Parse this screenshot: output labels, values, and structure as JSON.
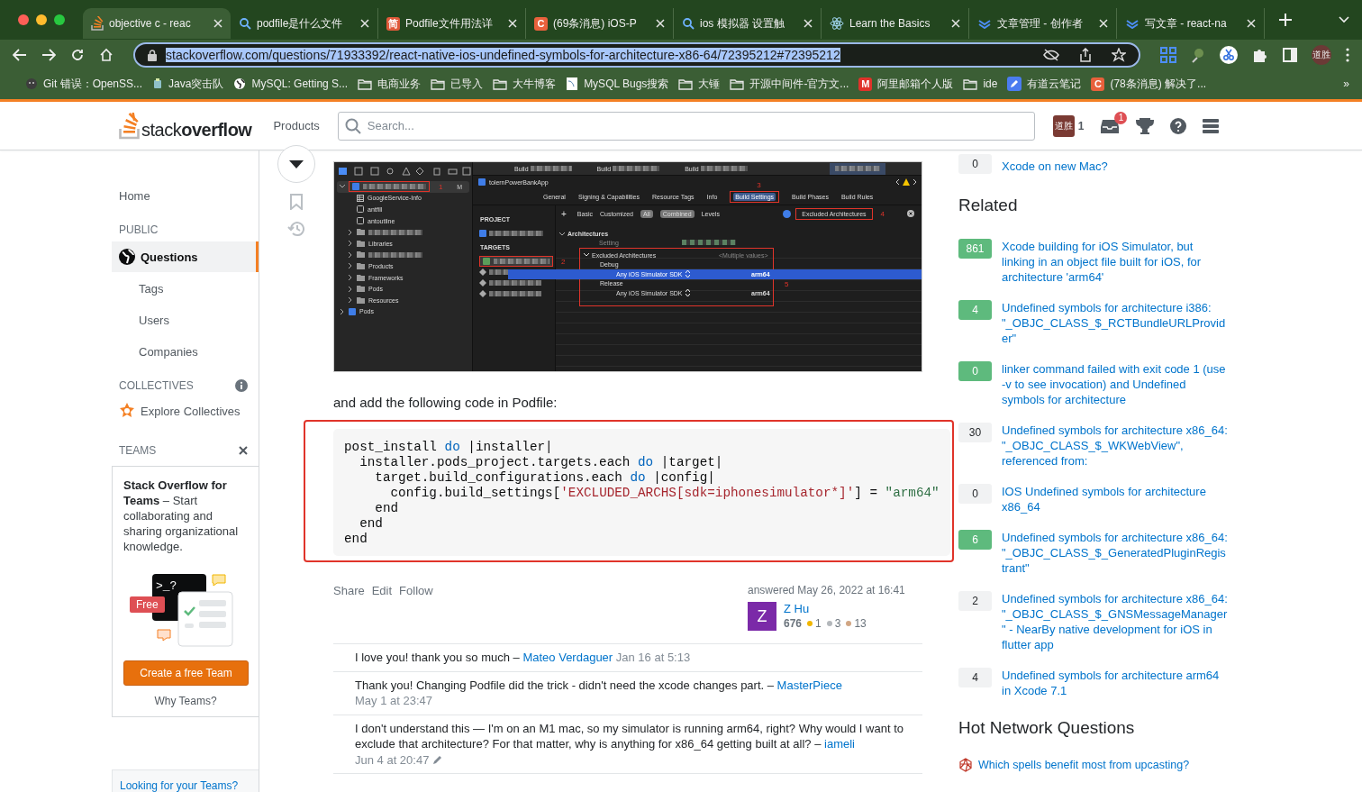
{
  "browser": {
    "tabs": [
      {
        "title": "objective c - reac",
        "kind": "logo",
        "selected": true
      },
      {
        "title": "podfile是什么文件",
        "kind": "search",
        "selected": false
      },
      {
        "title": "Podfile文件用法详",
        "kind": "letter",
        "icon_text": "简",
        "color": "#e05a3a",
        "selected": false
      },
      {
        "title": "(69条消息) iOS-P",
        "kind": "letter",
        "icon_text": "C",
        "color": "#e8613c",
        "selected": false
      },
      {
        "title": "ios 模拟器 设置触",
        "kind": "search",
        "selected": false
      },
      {
        "title": "Learn the Basics",
        "kind": "atom",
        "selected": false
      },
      {
        "title": "文章管理 - 创作者",
        "kind": "chevrons",
        "selected": false
      },
      {
        "title": "写文章 - react-na",
        "kind": "chevrons",
        "selected": false
      }
    ],
    "url": "stackoverflow.com/questions/71933392/react-native-ios-undefined-symbols-for-architecture-x86-64/72395212#72395212",
    "profile": "道胜",
    "bookmarks": [
      {
        "label": "Git 错误：OpenSS...",
        "kind": "octo"
      },
      {
        "label": "Java突击队",
        "kind": "site"
      },
      {
        "label": "MySQL: Getting S...",
        "kind": "globe"
      },
      {
        "label": "电商业务",
        "kind": "folder"
      },
      {
        "label": "已导入",
        "kind": "folder"
      },
      {
        "label": "大牛博客",
        "kind": "folder"
      },
      {
        "label": "MySQL Bugs搜索",
        "kind": "doc"
      },
      {
        "label": "大锤",
        "kind": "folder"
      },
      {
        "label": "开源中间件-官方文...",
        "kind": "folder"
      },
      {
        "label": "阿里邮箱个人版",
        "kind": "letter",
        "icon_text": "M",
        "color": "#e0322a"
      },
      {
        "label": "ide",
        "kind": "folder"
      },
      {
        "label": "有道云笔记",
        "kind": "pen"
      },
      {
        "label": "(78条消息) 解决了...",
        "kind": "letter",
        "icon_text": "C",
        "color": "#e8613c"
      }
    ],
    "more": "»"
  },
  "topbar": {
    "logo": "stack**overflow**",
    "products": "Products",
    "search": {
      "placeholder": "Search..."
    },
    "avatar": "道胜",
    "reputation": "1",
    "inbox_count": "1"
  },
  "left_nav": {
    "items": [
      {
        "label": "Home",
        "kind": "link",
        "selected": false
      },
      {
        "label": "PUBLIC",
        "kind": "heading"
      },
      {
        "label": "Questions",
        "kind": "main",
        "selected": true
      },
      {
        "label": "Tags",
        "kind": "sub",
        "selected": false
      },
      {
        "label": "Users",
        "kind": "sub",
        "selected": false
      },
      {
        "label": "Companies",
        "kind": "sub",
        "selected": false
      },
      {
        "label": "COLLECTIVES",
        "kind": "heading-info"
      },
      {
        "label": "Explore Collectives",
        "kind": "collective",
        "selected": false
      },
      {
        "label": "TEAMS",
        "kind": "heading-close"
      }
    ],
    "teams_card": {
      "text": "**Stack Overflow for Teams** – Start collaborating and sharing organizational knowledge.",
      "free": "Free",
      "prompt": ">_?",
      "button": "Create a free Team",
      "why": "Why Teams?"
    },
    "looking": "Looking for your Teams?"
  },
  "xcode": {
    "toolbar": [
      "Build",
      "Build",
      "Build"
    ],
    "project": "tolernPowerBankApp",
    "navigator": [
      {
        "kind": "project",
        "blurred": true,
        "marker": "1",
        "badge": "M",
        "children": [
          {
            "label": "GoogleService-Info",
            "kind": "table",
            "blurred": false
          },
          {
            "label": "antfill",
            "kind": "file",
            "blurred": false
          },
          {
            "label": "antoutline",
            "kind": "file",
            "blurred": false
          },
          {
            "kind": "folder",
            "blurred": true
          },
          {
            "label": "Libraries",
            "kind": "folder",
            "blurred": false
          },
          {
            "kind": "folder",
            "blurred": true
          },
          {
            "label": "Products",
            "kind": "folder",
            "blurred": false
          },
          {
            "label": "Frameworks",
            "kind": "folder",
            "blurred": false
          },
          {
            "label": "Pods",
            "kind": "folder",
            "blurred": false
          },
          {
            "label": "Resources",
            "kind": "folder",
            "blurred": false
          }
        ]
      },
      {
        "label": "Pods",
        "kind": "project",
        "blurred": false
      }
    ],
    "tabs": [
      {
        "label": "General",
        "selected": false
      },
      {
        "label": "Signing & Capabilities",
        "selected": false
      },
      {
        "label": "Resource Tags",
        "selected": false
      },
      {
        "label": "Info",
        "selected": false
      },
      {
        "label": "Build Settings",
        "selected": true,
        "marker": "3"
      },
      {
        "label": "Build Phases",
        "selected": false
      },
      {
        "label": "Build Rules",
        "selected": false
      }
    ],
    "add": "+",
    "filters": [
      {
        "label": "Basic",
        "selected": false
      },
      {
        "label": "Customized",
        "selected": false
      },
      {
        "label": "All",
        "selected": true
      },
      {
        "label": "Combined",
        "selected": true
      },
      {
        "label": "Levels",
        "selected": false
      }
    ],
    "search": {
      "value": "Excluded Architectures",
      "marker": "4"
    },
    "project_header": "PROJECT",
    "targets_header": "TARGETS",
    "target_marker": "2",
    "section": "Architectures",
    "setting_header": "Setting",
    "settings": [
      {
        "label": "Excluded Architectures",
        "value": "<Multiple values>",
        "selected": false,
        "children": [
          {
            "label": "Debug",
            "selected": false,
            "children": [
              {
                "label": "Any iOS Simulator SDK",
                "value": "arm64",
                "selected": true
              }
            ]
          },
          {
            "label": "Release",
            "selected": false,
            "children": [
              {
                "label": "Any iOS Simulator SDK",
                "value": "arm64",
                "selected": false
              }
            ]
          }
        ]
      }
    ],
    "settings_marker": "5"
  },
  "answer": {
    "intro": "and add the following code in Podfile:",
    "code": [
      [
        {
          "kind": "plain",
          "text": "post_install "
        },
        {
          "kind": "keyword",
          "text": "do"
        },
        {
          "kind": "plain",
          "text": " |installer|"
        }
      ],
      [
        {
          "kind": "plain",
          "text": "  installer.pods_project.targets.each "
        },
        {
          "kind": "keyword",
          "text": "do"
        },
        {
          "kind": "plain",
          "text": " |target|"
        }
      ],
      [
        {
          "kind": "plain",
          "text": "    target.build_configurations.each "
        },
        {
          "kind": "keyword",
          "text": "do"
        },
        {
          "kind": "plain",
          "text": " |config|"
        }
      ],
      [
        {
          "kind": "plain",
          "text": "      config.build_settings["
        },
        {
          "kind": "literal",
          "text": "'EXCLUDED_ARCHS[sdk=iphonesimulator*]'"
        },
        {
          "kind": "plain",
          "text": "] = "
        },
        {
          "kind": "string",
          "text": "\"arm64\""
        }
      ],
      [
        {
          "kind": "plain",
          "text": "    end"
        }
      ],
      [
        {
          "kind": "plain",
          "text": "  end"
        }
      ],
      [
        {
          "kind": "plain",
          "text": "end"
        }
      ]
    ],
    "actions": [
      "Share",
      "Edit",
      "Follow"
    ],
    "answered": "answered May 26, 2022 at 16:41",
    "user": {
      "initial": "Z",
      "name": "Z Hu",
      "reputation": "676",
      "badges": [
        {
          "count": "1",
          "color": "#f1b600"
        },
        {
          "count": "3",
          "color": "#b4b8bc"
        },
        {
          "count": "13",
          "color": "#d1a684"
        }
      ]
    },
    "comments": [
      {
        "text": "I love you! thank you so much –",
        "author": "Mateo Verdaguer",
        "date": "Jan 16 at 5:13",
        "edited": false
      },
      {
        "text": "Thank you! Changing Podfile did the trick - didn't need the xcode changes part. –",
        "author": "MasterPiece",
        "date": "May 1 at 23:47",
        "edited": false
      },
      {
        "text": "I don't understand this — I'm on an M1 mac, so my simulator is running arm64, right? Why would I want to exclude that architecture? For that matter, why is anything for x86_64 getting built at all? –",
        "author": "iameli",
        "date": "Jun 4 at 20:47",
        "edited": true
      }
    ]
  },
  "right": {
    "linked_tail": {
      "count": "0",
      "title": "Xcode on new Mac?",
      "accepted": false
    },
    "related_title": "Related",
    "related": [
      {
        "count": "861",
        "accepted": true,
        "title": "Xcode building for iOS Simulator, but linking in an object file built for iOS, for architecture 'arm64'"
      },
      {
        "count": "4",
        "accepted": true,
        "title": "Undefined symbols for architecture i386: \"_OBJC_CLASS_$_RCTBundleURLProvider\""
      },
      {
        "count": "0",
        "accepted": true,
        "title": "linker command failed with exit code 1 (use -v to see invocation) and Undefined symbols for architecture"
      },
      {
        "count": "30",
        "accepted": false,
        "title": "Undefined symbols for architecture x86_64: \"_OBJC_CLASS_$_WKWebView\", referenced from:"
      },
      {
        "count": "0",
        "accepted": false,
        "title": "IOS Undefined symbols for architecture x86_64"
      },
      {
        "count": "6",
        "accepted": true,
        "title": "Undefined symbols for architecture x86_64: \"_OBJC_CLASS_$_GeneratedPluginRegistrant\""
      },
      {
        "count": "2",
        "accepted": false,
        "title": "Undefined symbols for architecture x86_64: \"_OBJC_CLASS_$_GNSMessageManager\" - NearBy native development for iOS in flutter app"
      },
      {
        "count": "4",
        "accepted": false,
        "title": "Undefined symbols for architecture arm64 in Xcode 7.1"
      }
    ],
    "hot_title": "Hot Network Questions",
    "hot": [
      {
        "title": "Which spells benefit most from upcasting?"
      }
    ]
  }
}
